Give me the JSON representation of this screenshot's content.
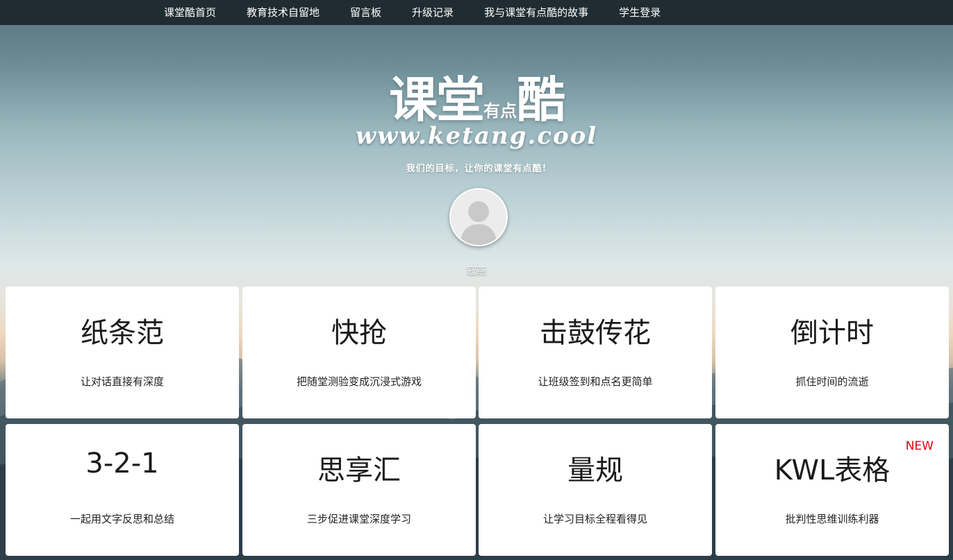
{
  "nav": {
    "items": [
      {
        "label": "课堂酷首页"
      },
      {
        "label": "教育技术自留地"
      },
      {
        "label": "留言板"
      },
      {
        "label": "升级记录"
      },
      {
        "label": "我与课堂有点酷的故事"
      },
      {
        "label": "学生登录"
      }
    ]
  },
  "hero": {
    "logo_part1": "课堂",
    "logo_part2": "有点",
    "logo_part3": "酷",
    "url": "www.ketang.cool",
    "slogan": "我们的目标，让你的课堂有点酷!",
    "username": "寇燕"
  },
  "cards": [
    {
      "title": "纸条范",
      "desc": "让对话直接有深度",
      "badge": ""
    },
    {
      "title": "快抢",
      "desc": "把随堂测验变成沉浸式游戏",
      "badge": ""
    },
    {
      "title": "击鼓传花",
      "desc": "让班级签到和点名更简单",
      "badge": ""
    },
    {
      "title": "倒计时",
      "desc": "抓住时间的流逝",
      "badge": ""
    },
    {
      "title": "3-2-1",
      "desc": "一起用文字反思和总结",
      "badge": ""
    },
    {
      "title": "思享汇",
      "desc": "三步促进课堂深度学习",
      "badge": ""
    },
    {
      "title": "量规",
      "desc": "让学习目标全程看得见",
      "badge": ""
    },
    {
      "title": "KWL表格",
      "desc": "批判性思维训练利器",
      "badge": "NEW"
    }
  ],
  "colors": {
    "nav_bg": "#1f2d33",
    "badge_red": "#e60012"
  },
  "icons": {
    "avatar": "default-user-avatar-icon"
  }
}
